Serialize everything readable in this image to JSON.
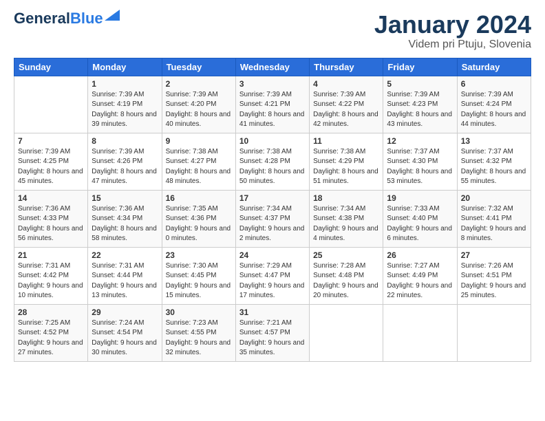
{
  "header": {
    "logo_general": "General",
    "logo_blue": "Blue",
    "month_title": "January 2024",
    "location": "Videm pri Ptuju, Slovenia"
  },
  "days_of_week": [
    "Sunday",
    "Monday",
    "Tuesday",
    "Wednesday",
    "Thursday",
    "Friday",
    "Saturday"
  ],
  "weeks": [
    [
      {
        "num": "",
        "sunrise": "",
        "sunset": "",
        "daylight": ""
      },
      {
        "num": "1",
        "sunrise": "7:39 AM",
        "sunset": "4:19 PM",
        "daylight": "8 hours and 39 minutes."
      },
      {
        "num": "2",
        "sunrise": "7:39 AM",
        "sunset": "4:20 PM",
        "daylight": "8 hours and 40 minutes."
      },
      {
        "num": "3",
        "sunrise": "7:39 AM",
        "sunset": "4:21 PM",
        "daylight": "8 hours and 41 minutes."
      },
      {
        "num": "4",
        "sunrise": "7:39 AM",
        "sunset": "4:22 PM",
        "daylight": "8 hours and 42 minutes."
      },
      {
        "num": "5",
        "sunrise": "7:39 AM",
        "sunset": "4:23 PM",
        "daylight": "8 hours and 43 minutes."
      },
      {
        "num": "6",
        "sunrise": "7:39 AM",
        "sunset": "4:24 PM",
        "daylight": "8 hours and 44 minutes."
      }
    ],
    [
      {
        "num": "7",
        "sunrise": "7:39 AM",
        "sunset": "4:25 PM",
        "daylight": "8 hours and 45 minutes."
      },
      {
        "num": "8",
        "sunrise": "7:39 AM",
        "sunset": "4:26 PM",
        "daylight": "8 hours and 47 minutes."
      },
      {
        "num": "9",
        "sunrise": "7:38 AM",
        "sunset": "4:27 PM",
        "daylight": "8 hours and 48 minutes."
      },
      {
        "num": "10",
        "sunrise": "7:38 AM",
        "sunset": "4:28 PM",
        "daylight": "8 hours and 50 minutes."
      },
      {
        "num": "11",
        "sunrise": "7:38 AM",
        "sunset": "4:29 PM",
        "daylight": "8 hours and 51 minutes."
      },
      {
        "num": "12",
        "sunrise": "7:37 AM",
        "sunset": "4:30 PM",
        "daylight": "8 hours and 53 minutes."
      },
      {
        "num": "13",
        "sunrise": "7:37 AM",
        "sunset": "4:32 PM",
        "daylight": "8 hours and 55 minutes."
      }
    ],
    [
      {
        "num": "14",
        "sunrise": "7:36 AM",
        "sunset": "4:33 PM",
        "daylight": "8 hours and 56 minutes."
      },
      {
        "num": "15",
        "sunrise": "7:36 AM",
        "sunset": "4:34 PM",
        "daylight": "8 hours and 58 minutes."
      },
      {
        "num": "16",
        "sunrise": "7:35 AM",
        "sunset": "4:36 PM",
        "daylight": "9 hours and 0 minutes."
      },
      {
        "num": "17",
        "sunrise": "7:34 AM",
        "sunset": "4:37 PM",
        "daylight": "9 hours and 2 minutes."
      },
      {
        "num": "18",
        "sunrise": "7:34 AM",
        "sunset": "4:38 PM",
        "daylight": "9 hours and 4 minutes."
      },
      {
        "num": "19",
        "sunrise": "7:33 AM",
        "sunset": "4:40 PM",
        "daylight": "9 hours and 6 minutes."
      },
      {
        "num": "20",
        "sunrise": "7:32 AM",
        "sunset": "4:41 PM",
        "daylight": "9 hours and 8 minutes."
      }
    ],
    [
      {
        "num": "21",
        "sunrise": "7:31 AM",
        "sunset": "4:42 PM",
        "daylight": "9 hours and 10 minutes."
      },
      {
        "num": "22",
        "sunrise": "7:31 AM",
        "sunset": "4:44 PM",
        "daylight": "9 hours and 13 minutes."
      },
      {
        "num": "23",
        "sunrise": "7:30 AM",
        "sunset": "4:45 PM",
        "daylight": "9 hours and 15 minutes."
      },
      {
        "num": "24",
        "sunrise": "7:29 AM",
        "sunset": "4:47 PM",
        "daylight": "9 hours and 17 minutes."
      },
      {
        "num": "25",
        "sunrise": "7:28 AM",
        "sunset": "4:48 PM",
        "daylight": "9 hours and 20 minutes."
      },
      {
        "num": "26",
        "sunrise": "7:27 AM",
        "sunset": "4:49 PM",
        "daylight": "9 hours and 22 minutes."
      },
      {
        "num": "27",
        "sunrise": "7:26 AM",
        "sunset": "4:51 PM",
        "daylight": "9 hours and 25 minutes."
      }
    ],
    [
      {
        "num": "28",
        "sunrise": "7:25 AM",
        "sunset": "4:52 PM",
        "daylight": "9 hours and 27 minutes."
      },
      {
        "num": "29",
        "sunrise": "7:24 AM",
        "sunset": "4:54 PM",
        "daylight": "9 hours and 30 minutes."
      },
      {
        "num": "30",
        "sunrise": "7:23 AM",
        "sunset": "4:55 PM",
        "daylight": "9 hours and 32 minutes."
      },
      {
        "num": "31",
        "sunrise": "7:21 AM",
        "sunset": "4:57 PM",
        "daylight": "9 hours and 35 minutes."
      },
      {
        "num": "",
        "sunrise": "",
        "sunset": "",
        "daylight": ""
      },
      {
        "num": "",
        "sunrise": "",
        "sunset": "",
        "daylight": ""
      },
      {
        "num": "",
        "sunrise": "",
        "sunset": "",
        "daylight": ""
      }
    ]
  ]
}
